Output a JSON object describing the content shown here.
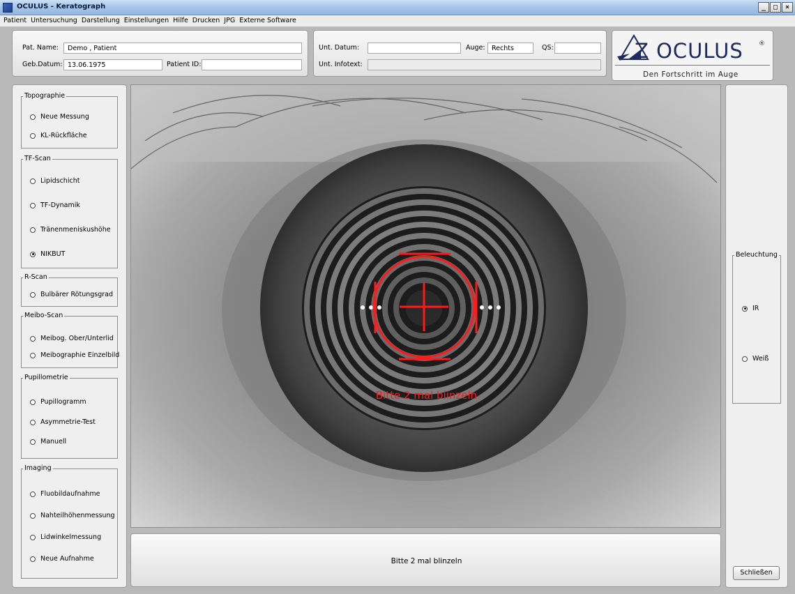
{
  "window": {
    "title": "OCULUS - Keratograph",
    "buttons": {
      "minimize": "_",
      "maximize": "□",
      "close": "×"
    }
  },
  "menu": [
    "Patient",
    "Untersuchung",
    "Darstellung",
    "Einstellungen",
    "Hilfe",
    "Drucken",
    "JPG",
    "Externe Software"
  ],
  "patient": {
    "name_label": "Pat. Name:",
    "name_value": "Demo , Patient",
    "dob_label": "Geb.Datum:",
    "dob_value": "13.06.1975",
    "id_label": "Patient ID:",
    "id_value": ""
  },
  "exam": {
    "date_label": "Unt. Datum:",
    "date_value": "",
    "eye_label": "Auge:",
    "eye_value": "Rechts",
    "qs_label": "QS:",
    "qs_value": "",
    "info_label": "Unt. Infotext:",
    "info_value": ""
  },
  "logo": {
    "word": "Z OCULUS",
    "registered": "®",
    "slogan": "Den Fortschritt im Auge",
    "color": "#1d2a5e"
  },
  "groups": {
    "topographie": {
      "title": "Topographie",
      "items": [
        "Neue Messung",
        "KL-Rückfläche"
      ]
    },
    "tfscan": {
      "title": "TF-Scan",
      "items": [
        "Lipidschicht",
        "TF-Dynamik",
        "Tränenmeniskushöhe",
        "NIKBUT"
      ]
    },
    "rscan": {
      "title": "R-Scan",
      "items": [
        "Bulbärer Rötungsgrad"
      ]
    },
    "meibo": {
      "title": "Meibo-Scan",
      "items": [
        "Meibog. Ober/Unterlid",
        "Meibographie Einzelbild"
      ]
    },
    "pupil": {
      "title": "Pupillometrie",
      "items": [
        "Pupillogramm",
        "Asymmetrie-Test",
        "Manuell"
      ]
    },
    "imaging": {
      "title": "Imaging",
      "items": [
        "Fluobildaufnahme",
        "Nahteilhöhenmessung",
        "Lidwinkelmessung",
        "Neue Aufnahme"
      ]
    }
  },
  "selected_mode": "NIKBUT",
  "illumination": {
    "title": "Beleuchtung",
    "items": [
      "IR",
      "Weiß"
    ],
    "selected": "IR"
  },
  "camera": {
    "overlay_text": "Bitte 2 mal blinzeln",
    "overlay_color": "#ff1a1a"
  },
  "status": {
    "message": "Bitte 2 mal blinzeln"
  },
  "close_button": "Schließen"
}
